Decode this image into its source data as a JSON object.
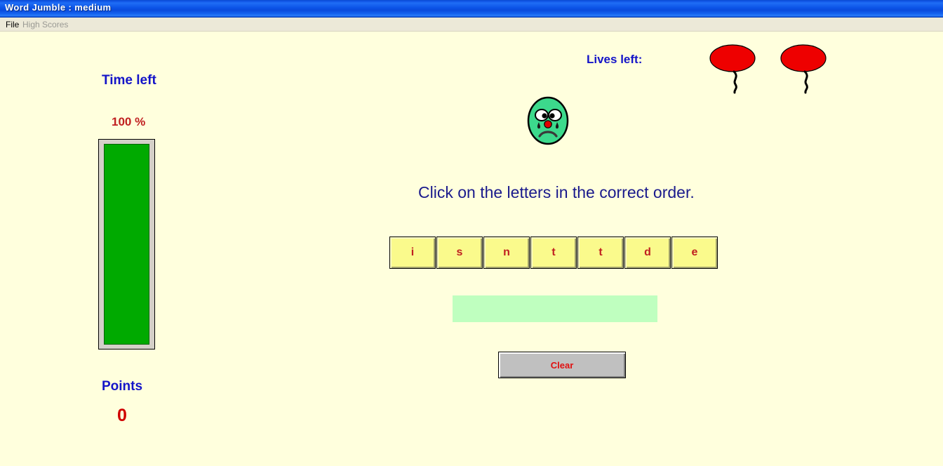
{
  "window": {
    "title": "Word Jumble :  medium",
    "titlebar_color": "#0C55E8",
    "menu": [
      {
        "label": "File",
        "enabled": true
      },
      {
        "label": "High Scores",
        "enabled": false
      }
    ]
  },
  "timer": {
    "label": "Time left",
    "percent_text": "100 %",
    "percent_value": 100,
    "bar_color": "#00AA00"
  },
  "score": {
    "label": "Points",
    "value": "0",
    "value_color": "#D00000"
  },
  "lives": {
    "label": "Lives left:",
    "count": 2,
    "balloon_color": "#EE0000",
    "items": [
      {
        "name": "balloon-1"
      },
      {
        "name": "balloon-2"
      }
    ]
  },
  "face": {
    "icon": "sad-face-icon",
    "expression": "sad",
    "fill_color": "#3CD98C",
    "nose_color": "#E00000"
  },
  "main": {
    "prompt": "Click on the letters in the correct order.",
    "prompt_color": "#1A1A8C",
    "letters": [
      "i",
      "s",
      "n",
      "t",
      "t",
      "d",
      "e"
    ],
    "tile_color": "#FAFA8C",
    "tile_text_color": "#C02020",
    "answer_value": "",
    "answer_placeholder": "",
    "answer_box_color": "#BFFFBF",
    "clear_label": "Clear",
    "clear_text_color": "#E01010"
  },
  "colors": {
    "page_background": "#FFFFDD",
    "menu_background": "#ECE9D8",
    "heading_blue": "#1414C8"
  }
}
